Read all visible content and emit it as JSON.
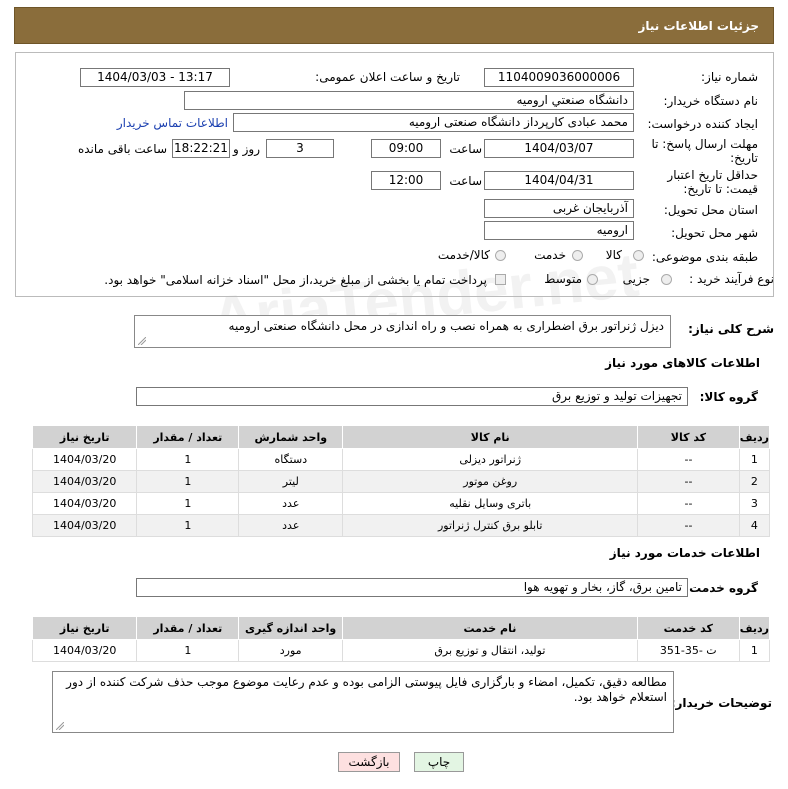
{
  "header": {
    "title": "جزئیات اطلاعات نیاز"
  },
  "form": {
    "need_number_label": "شماره نیاز:",
    "need_number": "1104009036000006",
    "announce_label": "تاریخ و ساعت اعلان عمومی:",
    "announce_value": "1404/03/03 - 13:17",
    "buyer_org_label": "نام دستگاه خریدار:",
    "buyer_org": "دانشگاه صنعتي اروميه",
    "creator_label": "ایجاد کننده درخواست:",
    "creator": "محمد عبادی کارپرداز دانشگاه صنعتی ارومیه",
    "contact_link": "اطلاعات تماس خریدار",
    "deadline_label": "مهلت ارسال پاسخ: تا تاریخ:",
    "deadline_date": "1404/03/07",
    "time_label": "ساعت",
    "deadline_time": "09:00",
    "days_value": "3",
    "days_label": "روز و",
    "remaining_time": "18:22:21",
    "remaining_label": "ساعت باقی مانده",
    "validity_label": "حداقل تاریخ اعتبار قیمت: تا تاریخ:",
    "validity_date": "1404/04/31",
    "validity_time": "12:00",
    "province_label": "استان محل تحویل:",
    "province": "آذربایجان غربی",
    "city_label": "شهر محل تحویل:",
    "city": "ارومیه",
    "category_label": "طبقه بندی موضوعی:",
    "category_options": [
      "کالا",
      "خدمت",
      "کالا/خدمت"
    ],
    "process_label": "نوع فرآیند خرید :",
    "process_options": [
      "جزیی",
      "متوسط"
    ],
    "payment_note": "پرداخت تمام یا بخشی از مبلغ خرید،از محل \"اسناد خزانه اسلامی\" خواهد بود."
  },
  "description": {
    "label": "شرح کلی نیاز:",
    "text": "دیزل ژنراتور برق اضطراری به همراه نصب و راه اندازی در محل دانشگاه صنعتی ارومیه"
  },
  "goods": {
    "section_title": "اطلاعات کالاهای مورد نیاز",
    "group_label": "گروه کالا:",
    "group_value": "تجهیزات تولید و توزیع برق",
    "columns": [
      "ردیف",
      "کد کالا",
      "نام کالا",
      "واحد شمارش",
      "تعداد / مقدار",
      "تاریخ نیاز"
    ],
    "rows": [
      [
        "1",
        "--",
        "ژنراتور دیزلی",
        "دستگاه",
        "1",
        "1404/03/20"
      ],
      [
        "2",
        "--",
        "روغن موتور",
        "لیتر",
        "1",
        "1404/03/20"
      ],
      [
        "3",
        "--",
        "باتری وسایل نقلیه",
        "عدد",
        "1",
        "1404/03/20"
      ],
      [
        "4",
        "--",
        "تابلو برق کنترل ژنراتور",
        "عدد",
        "1",
        "1404/03/20"
      ]
    ]
  },
  "services": {
    "section_title": "اطلاعات خدمات مورد نیاز",
    "group_label": "گروه خدمت:",
    "group_value": "تامین برق، گاز، بخار و تهویه هوا",
    "columns": [
      "ردیف",
      "کد خدمت",
      "نام خدمت",
      "واحد اندازه گیری",
      "تعداد / مقدار",
      "تاریخ نیاز"
    ],
    "rows": [
      [
        "1",
        "ت -35-351",
        "تولید، انتقال و توزیع برق",
        "مورد",
        "1",
        "1404/03/20"
      ]
    ]
  },
  "notes": {
    "label": "توضیحات خریدار:",
    "text": "مطالعه دقیق، تکمیل، امضاء و بارگزاری فایل پیوستی الزامی بوده و عدم رعایت موضوع موجب حذف شرکت کننده از دور استعلام خواهد بود."
  },
  "buttons": {
    "print": "چاپ",
    "back": "بازگشت"
  },
  "watermark": "AriaTender.net",
  "colors": {
    "header_bg": "#8a6d3b",
    "back_button_bg": "#fde0e0",
    "print_button_bg": "#e3f5e3"
  }
}
